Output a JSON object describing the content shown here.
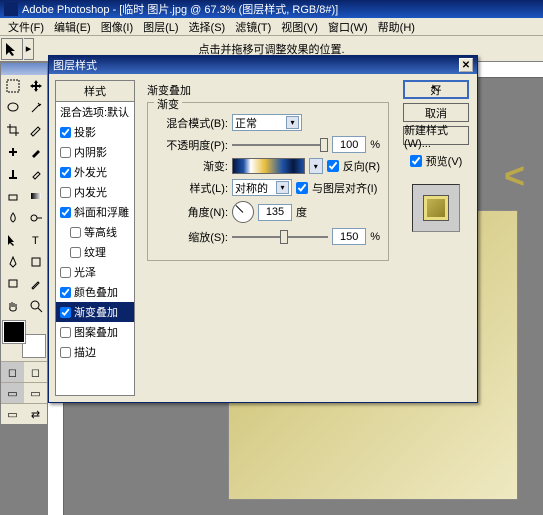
{
  "app": {
    "title": "Adobe Photoshop - [临时 图片.jpg @ 67.3% (图层样式, RGB/8#)]"
  },
  "menu": {
    "file": "文件(F)",
    "edit": "编辑(E)",
    "image": "图像(I)",
    "layer": "图层(L)",
    "select": "选择(S)",
    "filter": "滤镜(T)",
    "view": "视图(V)",
    "window": "窗口(W)",
    "help": "帮助(H)"
  },
  "options": {
    "hint": "点击并拖移可调整效果的位置."
  },
  "dialog": {
    "title": "图层样式",
    "styles_header": "样式",
    "items": [
      {
        "label": "混合选项:默认",
        "checked": false,
        "nocb": true
      },
      {
        "label": "投影",
        "checked": true
      },
      {
        "label": "内阴影",
        "checked": false
      },
      {
        "label": "外发光",
        "checked": true
      },
      {
        "label": "内发光",
        "checked": false
      },
      {
        "label": "斜面和浮雕",
        "checked": true
      },
      {
        "label": "等高线",
        "checked": false,
        "indent": true
      },
      {
        "label": "纹理",
        "checked": false,
        "indent": true
      },
      {
        "label": "光泽",
        "checked": false
      },
      {
        "label": "颜色叠加",
        "checked": true
      },
      {
        "label": "渐变叠加",
        "checked": true,
        "selected": true
      },
      {
        "label": "图案叠加",
        "checked": false
      },
      {
        "label": "描边",
        "checked": false
      }
    ],
    "panel_title": "渐变叠加",
    "group_title": "渐变",
    "blend_label": "混合模式(B):",
    "blend_value": "正常",
    "opacity_label": "不透明度(P):",
    "opacity_value": "100",
    "pct": "%",
    "grad_label": "渐变:",
    "reverse": "反向(R)",
    "style_label": "样式(L):",
    "style_value": "对称的",
    "align": "与图层对齐(I)",
    "angle_label": "角度(N):",
    "angle_value": "135",
    "deg": "度",
    "scale_label": "缩放(S):",
    "scale_value": "150",
    "ok": "好",
    "cancel": "取消",
    "new": "新建样式(W)...",
    "preview": "预览(V)"
  }
}
